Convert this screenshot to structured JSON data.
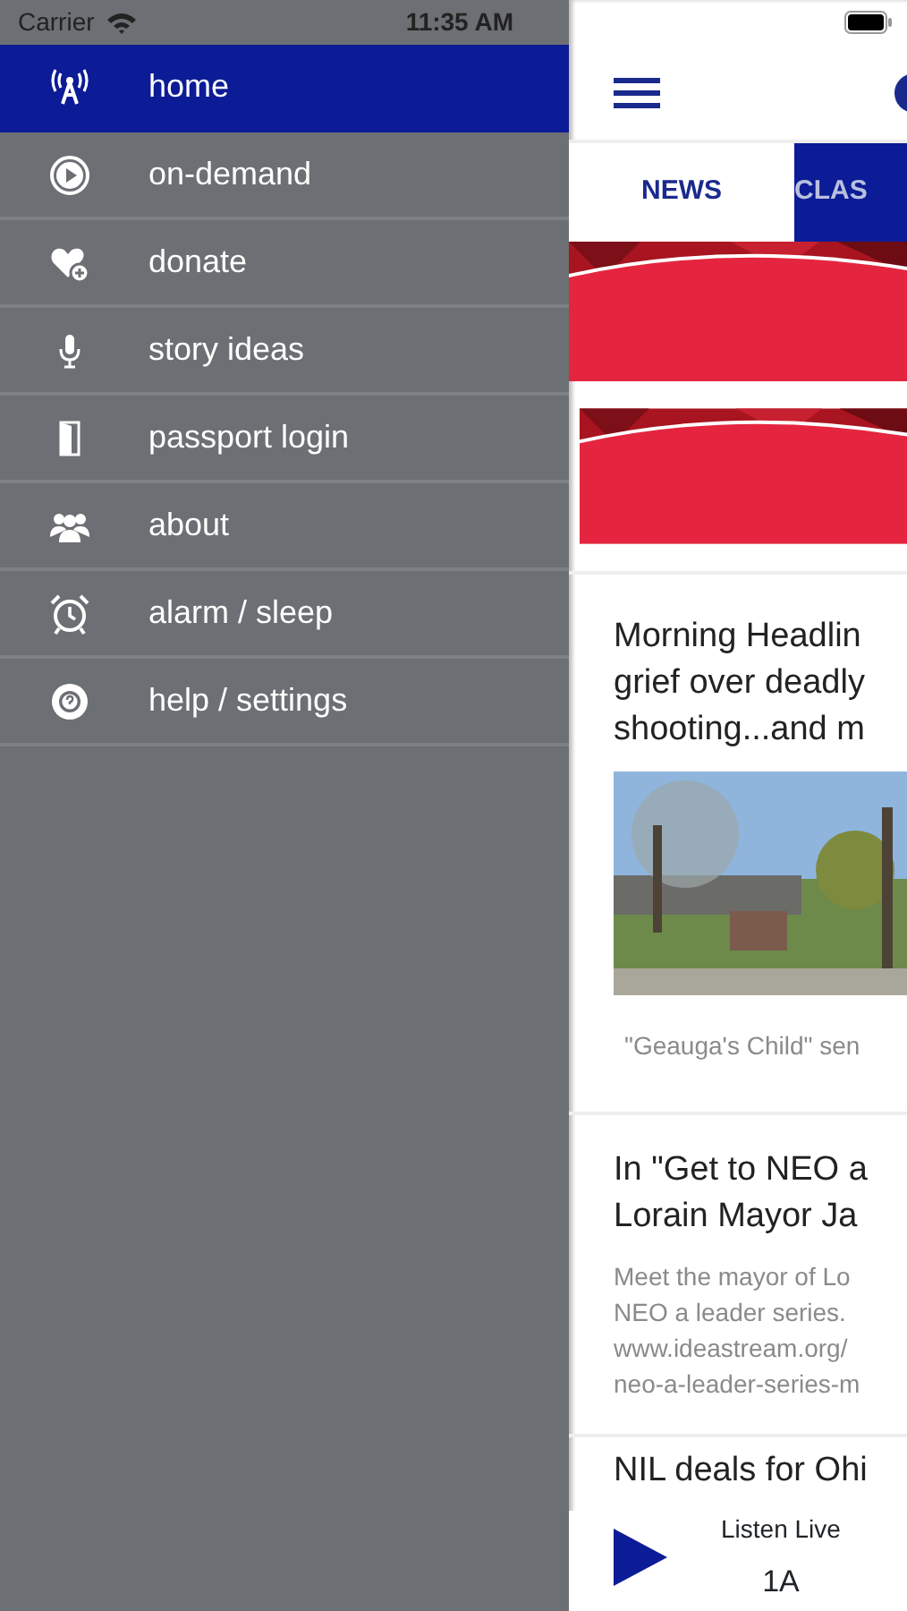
{
  "status_bar": {
    "carrier": "Carrier",
    "time": "11:35 AM"
  },
  "menu": [
    {
      "label": "home",
      "selected": true
    },
    {
      "label": "on-demand",
      "selected": false
    },
    {
      "label": "donate",
      "selected": false
    },
    {
      "label": "story ideas",
      "selected": false
    },
    {
      "label": "passport login",
      "selected": false
    },
    {
      "label": "about",
      "selected": false
    },
    {
      "label": "alarm / sleep",
      "selected": false
    },
    {
      "label": "help / settings",
      "selected": false
    }
  ],
  "tabs": [
    {
      "label": "NEWS",
      "selected": true
    },
    {
      "label": "CLAS",
      "selected": false
    }
  ],
  "banners": [
    {
      "kind": "picture"
    },
    {
      "kind": "picture"
    }
  ],
  "articles": [
    {
      "title_lines": [
        "Morning Headlin",
        "grief over deadly",
        "shooting...and m"
      ],
      "image": {
        "kind": "picture"
      },
      "caption": "\"Geauga's Child\" sen"
    },
    {
      "title_lines": [
        "In \"Get to NEO a",
        "Lorain Mayor Ja"
      ],
      "description_lines": [
        "Meet the mayor of Lo",
        "NEO a leader series.",
        "www.ideastream.org/",
        "neo-a-leader-series-m"
      ]
    },
    {
      "title_lines": [
        "NIL deals for Ohi"
      ]
    }
  ],
  "player": {
    "label": "Listen Live",
    "program": "1A"
  }
}
